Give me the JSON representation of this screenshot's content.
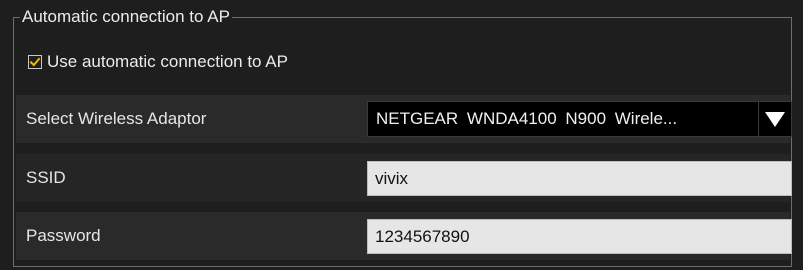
{
  "group": {
    "title": "Automatic connection to AP"
  },
  "auto_connect": {
    "label": "Use automatic connection to AP",
    "checked": true,
    "check_color": "#f2b705"
  },
  "adaptor": {
    "label": "Select Wireless Adaptor",
    "selected": "NETGEAR  WNDA4100  N900  Wirele...",
    "dropdown_icon": "triangle-down"
  },
  "ssid": {
    "label": "SSID",
    "value": "vivix"
  },
  "password": {
    "label": "Password",
    "value": "1234567890"
  }
}
